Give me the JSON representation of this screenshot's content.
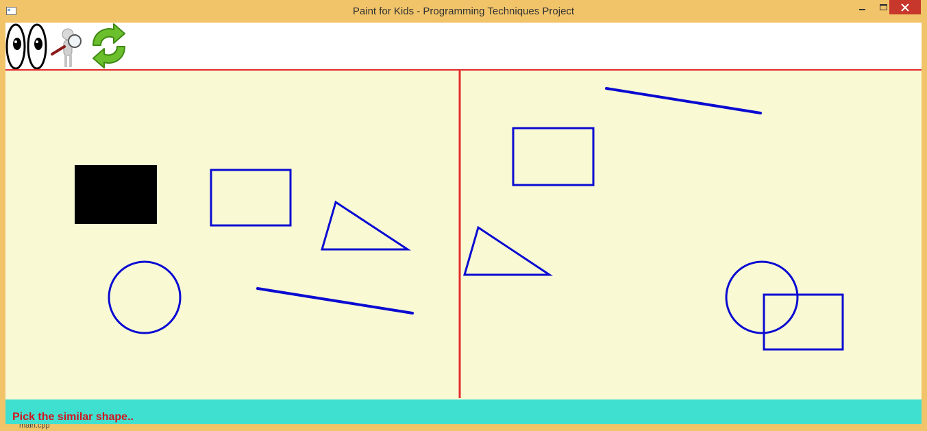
{
  "window": {
    "title": "Paint for Kids - Programming Techniques Project",
    "frame_color": "#f1c46a",
    "close_color": "#c7372b"
  },
  "toolbar": {
    "background": "#ffffff",
    "separator_color": "#e32b2b",
    "tools": [
      {
        "name": "eyes-icon"
      },
      {
        "name": "magnifier-person-icon"
      },
      {
        "name": "refresh-icon"
      }
    ]
  },
  "canvas": {
    "background": "#f9f9d4",
    "divider_color": "#e32b2b",
    "shape_color": "#0a0ad2",
    "fill_color": "#000000"
  },
  "status": {
    "message": "Pick the similar shape..",
    "background": "#40e0d0",
    "text_color": "#d2151e"
  },
  "behind_window_text": "main.cpp"
}
